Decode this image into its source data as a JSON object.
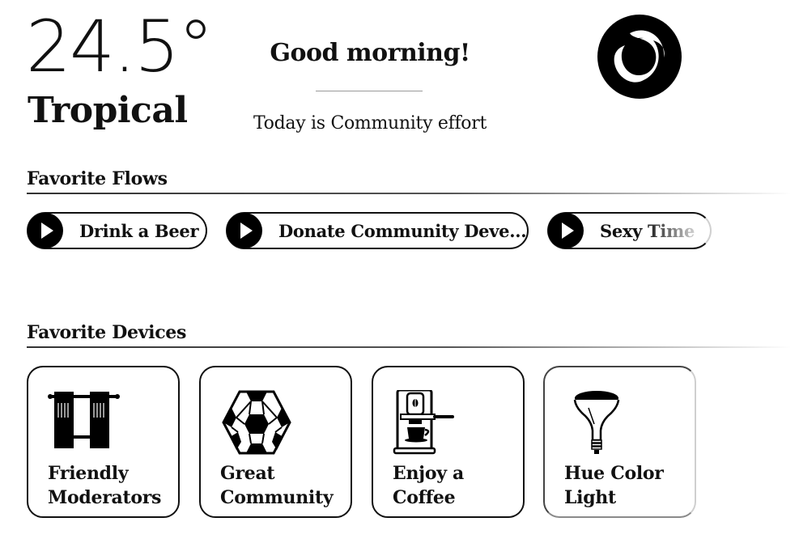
{
  "header": {
    "temperature": "24.5°",
    "weather": "Tropical",
    "greeting": "Good morning!",
    "today": "Today is Community effort"
  },
  "flows": {
    "title": "Favorite Flows",
    "items": [
      {
        "label": "Drink a Beer",
        "icon": "play-icon"
      },
      {
        "label": "Donate Community Deve...",
        "icon": "play-icon"
      },
      {
        "label": "Sexy Time",
        "icon": "play-icon"
      }
    ]
  },
  "devices": {
    "title": "Favorite Devices",
    "items": [
      {
        "line1": "Friendly",
        "line2": "Moderators",
        "icon": "curtains-icon"
      },
      {
        "line1": "Great",
        "line2": "Community",
        "icon": "soccer-ball-icon"
      },
      {
        "line1": "Enjoy a",
        "line2": "Coffee",
        "icon": "coffee-machine-icon"
      },
      {
        "line1": "Hue Color",
        "line2": "Light",
        "icon": "light-bulb-icon"
      }
    ]
  }
}
